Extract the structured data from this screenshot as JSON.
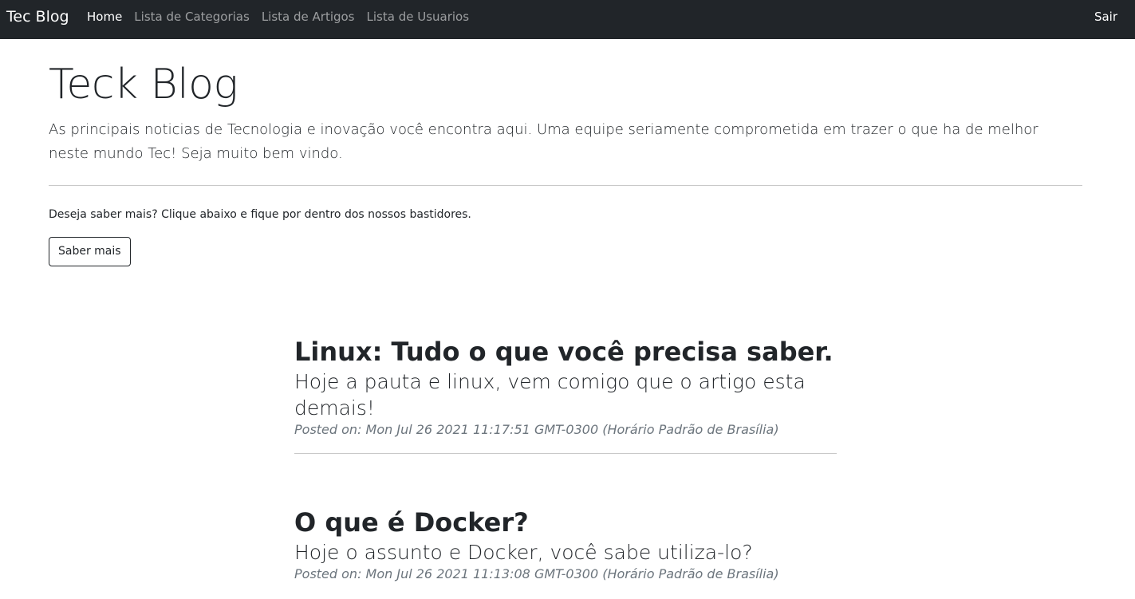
{
  "navbar": {
    "brand": "Tec Blog",
    "links": [
      {
        "label": "Home"
      },
      {
        "label": "Lista de Categorias"
      },
      {
        "label": "Lista de Artigos"
      },
      {
        "label": "Lista de Usuarios"
      }
    ],
    "logout_label": "Sair"
  },
  "hero": {
    "title": "Teck Blog",
    "lead": "As principais noticias de Tecnologia e inovação você encontra aqui. Uma equipe seriamente comprometida em trazer o que ha de melhor neste mundo Tec! Seja muito bem vindo.",
    "info": "Deseja saber mais? Clique abaixo e fique por dentro dos nossos bastidores.",
    "button_label": "Saber mais"
  },
  "posts": [
    {
      "title": "Linux: Tudo o que você precisa saber.",
      "subtitle": "Hoje a pauta e linux, vem comigo que o artigo esta demais!",
      "meta": "Posted on: Mon Jul 26 2021 11:17:51 GMT-0300 (Horário Padrão de Brasília)"
    },
    {
      "title": "O que é Docker?",
      "subtitle": "Hoje o assunto e Docker, você sabe utiliza-lo?",
      "meta": "Posted on: Mon Jul 26 2021 11:13:08 GMT-0300 (Horário Padrão de Brasília)"
    }
  ],
  "colors": {
    "navbar_bg": "#212529",
    "text": "#212529",
    "muted": "#6c757d"
  }
}
